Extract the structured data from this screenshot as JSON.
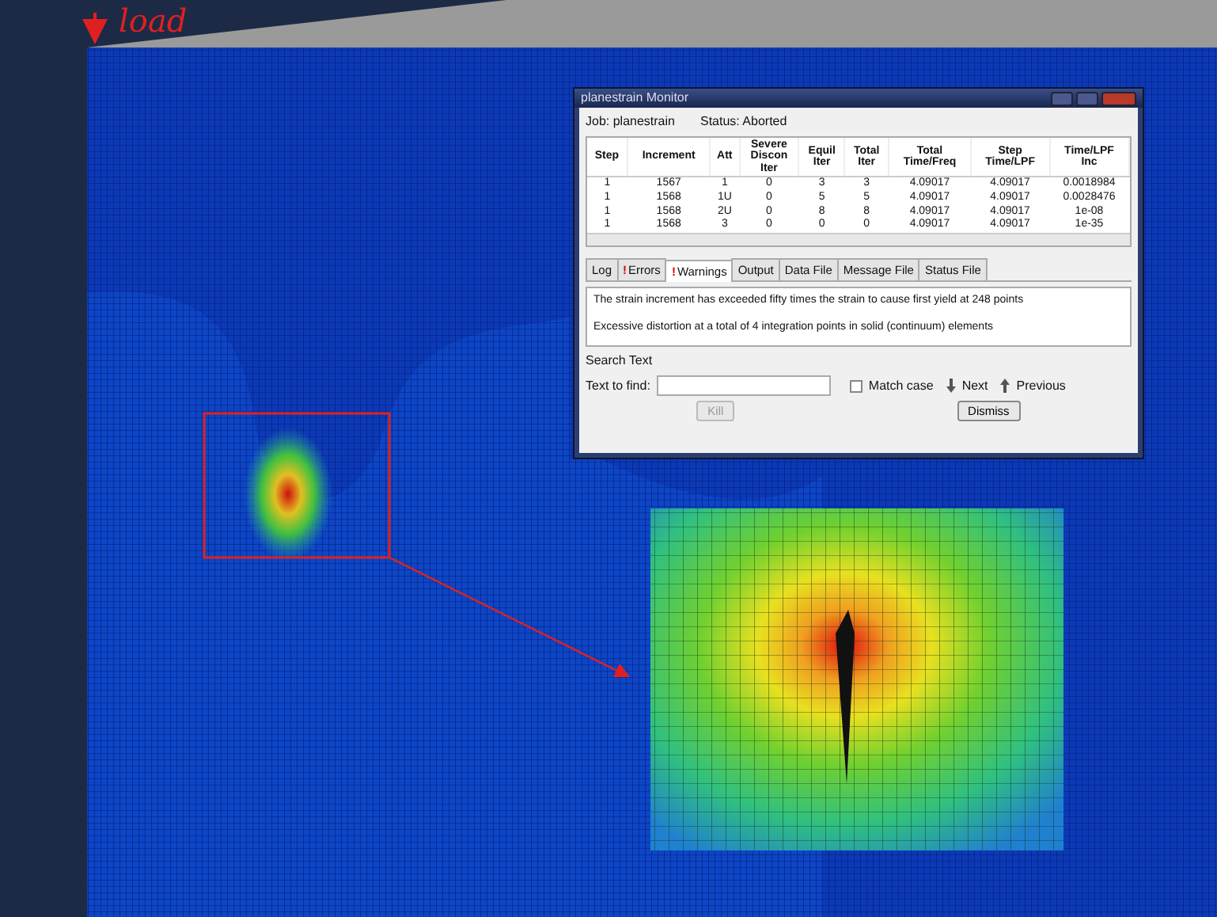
{
  "annotation": {
    "label": "load"
  },
  "monitor": {
    "title": "planestrain Monitor",
    "job_label": "Job:",
    "job": "planestrain",
    "status_label": "Status:",
    "status": "Aborted",
    "table": {
      "columns": [
        "Step",
        "Increment",
        "Att",
        "Severe\nDiscon\nIter",
        "Equil\nIter",
        "Total\nIter",
        "Total\nTime/Freq",
        "Step\nTime/LPF",
        "Time/LPF\nInc"
      ],
      "rows": [
        [
          "1",
          "1567",
          "1",
          "0",
          "3",
          "3",
          "4.09017",
          "4.09017",
          "0.0018984"
        ],
        [
          "1",
          "1568",
          "1U",
          "0",
          "5",
          "5",
          "4.09017",
          "4.09017",
          "0.0028476"
        ],
        [
          "1",
          "1568",
          "2U",
          "0",
          "8",
          "8",
          "4.09017",
          "4.09017",
          "1e-08"
        ],
        [
          "1",
          "1568",
          "3",
          "0",
          "0",
          "0",
          "4.09017",
          "4.09017",
          "1e-35"
        ]
      ]
    },
    "tabs": [
      {
        "label": "Log",
        "selected": false
      },
      {
        "label": "Errors",
        "marker": "!",
        "selected": false
      },
      {
        "label": "Warnings",
        "marker": "!",
        "selected": true
      },
      {
        "label": "Output",
        "selected": false
      },
      {
        "label": "Data File",
        "selected": false
      },
      {
        "label": "Message File",
        "selected": false
      },
      {
        "label": "Status File",
        "selected": false
      }
    ],
    "messages": [
      "The strain increment has exceeded fifty times the strain to cause first yield at 248 points",
      "Excessive distortion at a total of 4 integration points in solid (continuum) elements"
    ],
    "search": {
      "group_label": "Search Text",
      "field_label": "Text to find:",
      "match_case": {
        "label": "Match case",
        "checked": false
      },
      "next": "Next",
      "previous": "Previous"
    },
    "buttons": [
      {
        "label": "Kill",
        "disabled": true
      },
      {
        "label": "Dismiss",
        "disabled": false
      }
    ]
  }
}
